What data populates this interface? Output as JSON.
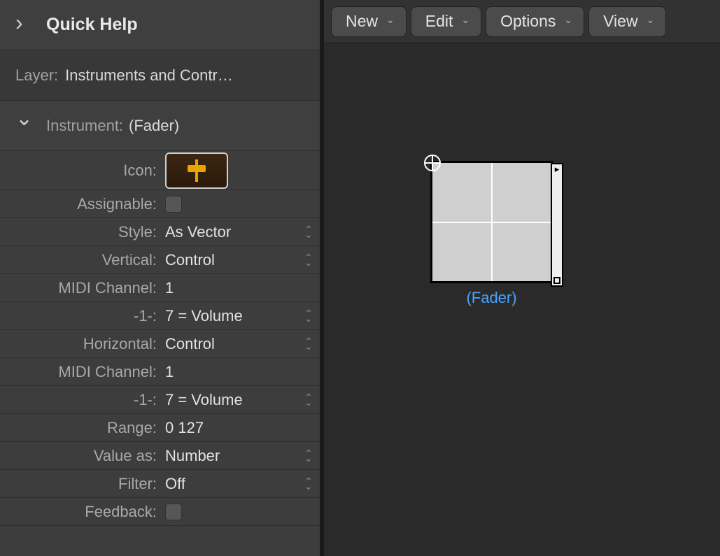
{
  "inspector": {
    "quick_help": "Quick Help",
    "layer_label": "Layer:",
    "layer_value": "Instruments and Contr…",
    "instrument_label": "Instrument:",
    "instrument_value": "(Fader)",
    "props": {
      "icon_label": "Icon:",
      "assignable_label": "Assignable:",
      "style_label": "Style:",
      "style_value": "As Vector",
      "vertical_label": "Vertical:",
      "vertical_value": "Control",
      "midi_v_label": "MIDI Channel:",
      "midi_v_value": "1",
      "cc_v_label": "-1-:",
      "cc_v_value": "7 = Volume",
      "horizontal_label": "Horizontal:",
      "horizontal_value": "Control",
      "midi_h_label": "MIDI Channel:",
      "midi_h_value": "1",
      "cc_h_label": "-1-:",
      "cc_h_value": "7 = Volume",
      "range_label": "Range:",
      "range_value": "0   127",
      "valueas_label": "Value as:",
      "valueas_value": "Number",
      "filter_label": "Filter:",
      "filter_value": "Off",
      "feedback_label": "Feedback:"
    }
  },
  "toolbar": {
    "new": "New",
    "edit": "Edit",
    "options": "Options",
    "view": "View"
  },
  "canvas": {
    "object_label": "(Fader)"
  }
}
